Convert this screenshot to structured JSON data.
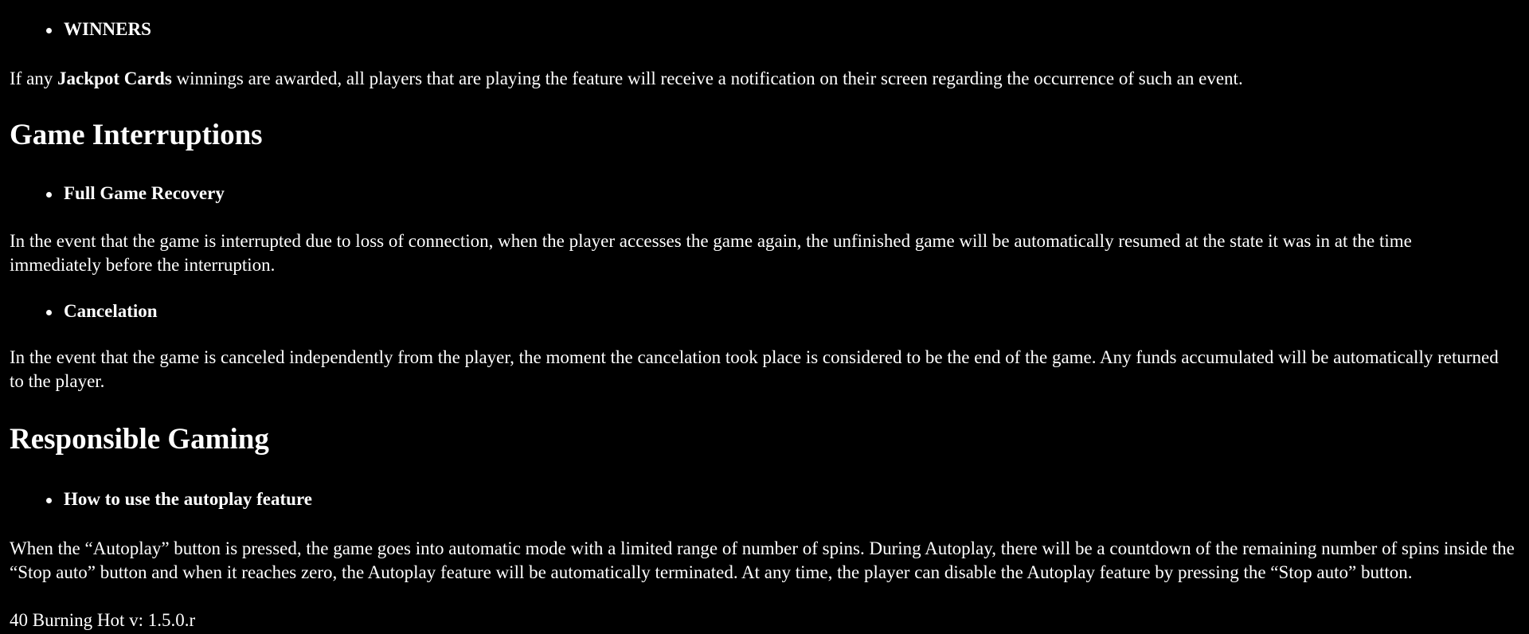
{
  "sections": {
    "winners_bullet": "WINNERS",
    "winners_text": {
      "before": "If any ",
      "bold": "Jackpot Cards",
      "after": " winnings are awarded, all players that are playing the feature will receive a notification on their screen regarding the occurrence of such an event."
    },
    "interruptions_heading": "Game Interruptions",
    "recovery_bullet": "Full Game Recovery",
    "recovery_text": "In the event that the game is interrupted due to loss of connection, when the player accesses the game again, the unfinished game will be automatically resumed at the state it was in at the time immediately before the interruption.",
    "cancelation_bullet": "Cancelation",
    "cancelation_text": "In the event that the game is canceled independently from the player, the moment the cancelation took place is considered to be the end of the game. Any funds accumulated will be automatically returned to the player.",
    "responsible_heading": "Responsible Gaming",
    "autoplay_bullet": "How to use the autoplay feature",
    "autoplay_text": "When the “Autoplay” button is pressed, the game goes into automatic mode with a limited range of number of spins. During Autoplay, there will be a countdown of the remaining number of spins inside the “Stop auto” button and when it reaches zero, the Autoplay feature will be automatically terminated. At any time, the player can disable the Autoplay feature by pressing the “Stop auto” button."
  },
  "footer": {
    "version": "40 Burning Hot v: 1.5.0.r"
  }
}
